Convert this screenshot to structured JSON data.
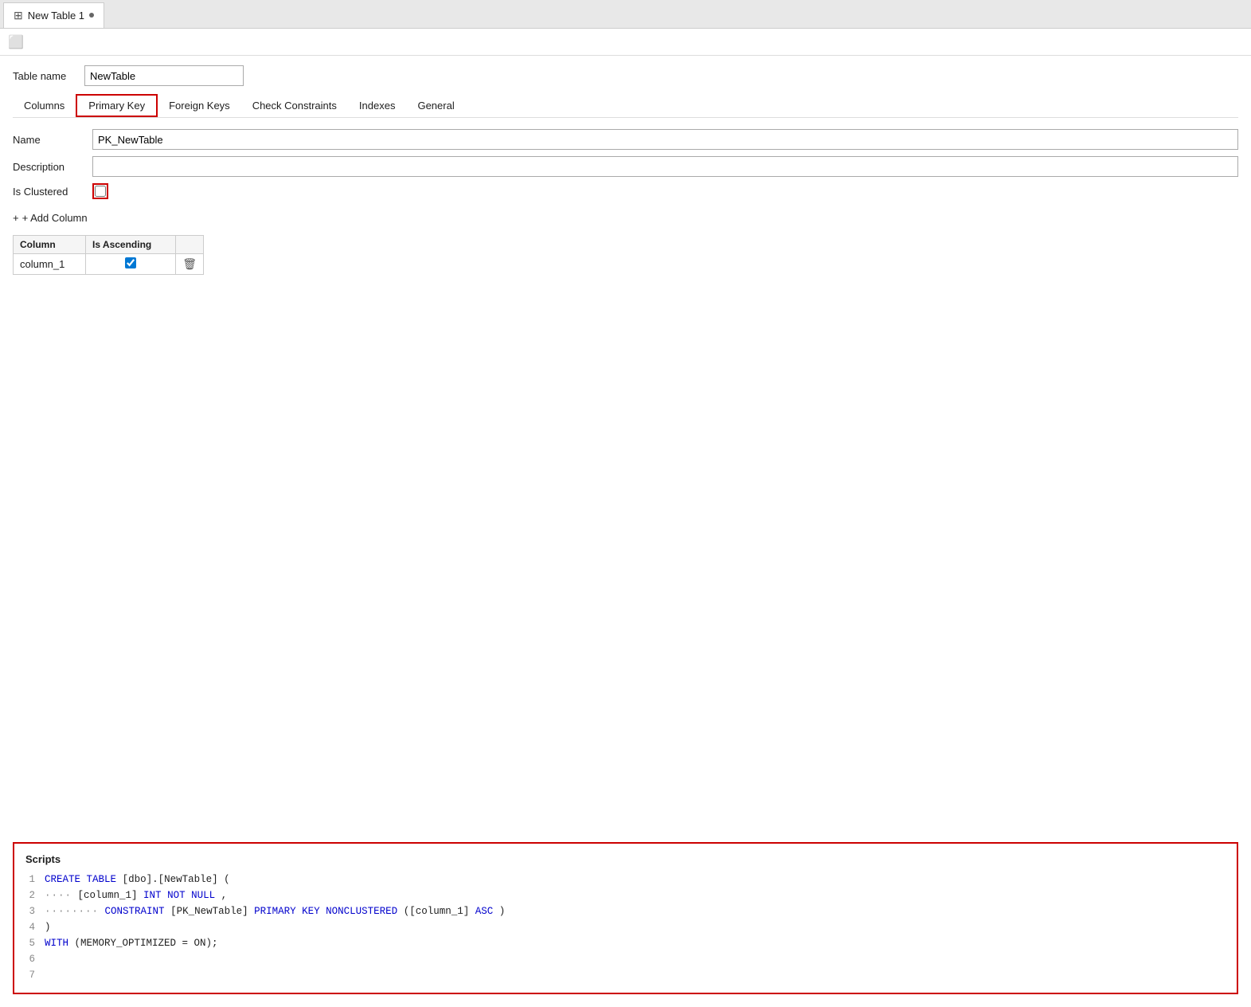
{
  "tab": {
    "icon": "🗃",
    "label": "New Table 1",
    "dot": true
  },
  "toolbar": {
    "save_icon": "💾"
  },
  "table_name_label": "Table name",
  "table_name_value": "NewTable",
  "tabs": [
    {
      "id": "columns",
      "label": "Columns",
      "active": false
    },
    {
      "id": "primary-key",
      "label": "Primary Key",
      "active": true
    },
    {
      "id": "foreign-keys",
      "label": "Foreign Keys",
      "active": false
    },
    {
      "id": "check-constraints",
      "label": "Check Constraints",
      "active": false
    },
    {
      "id": "indexes",
      "label": "Indexes",
      "active": false
    },
    {
      "id": "general",
      "label": "General",
      "active": false
    }
  ],
  "pk": {
    "name_label": "Name",
    "name_value": "PK_NewTable",
    "description_label": "Description",
    "description_value": "",
    "is_clustered_label": "Is Clustered",
    "is_clustered": false,
    "add_column_label": "+ Add Column",
    "columns_table": {
      "headers": [
        "Column",
        "Is Ascending",
        ""
      ],
      "rows": [
        {
          "column": "column_1",
          "is_ascending": true
        }
      ]
    }
  },
  "scripts": {
    "title": "Scripts",
    "lines": [
      {
        "num": "1",
        "code": "CREATE TABLE [dbo].[NewTable] ("
      },
      {
        "num": "2",
        "code": "    [column_1] INT NOT NULL,"
      },
      {
        "num": "3",
        "code": "    CONSTRAINT [PK_NewTable] PRIMARY KEY NONCLUSTERED ([column_1] ASC)"
      },
      {
        "num": "4",
        "code": ")"
      },
      {
        "num": "5",
        "code": "WITH (MEMORY_OPTIMIZED = ON);"
      },
      {
        "num": "6",
        "code": ""
      },
      {
        "num": "7",
        "code": ""
      }
    ]
  }
}
